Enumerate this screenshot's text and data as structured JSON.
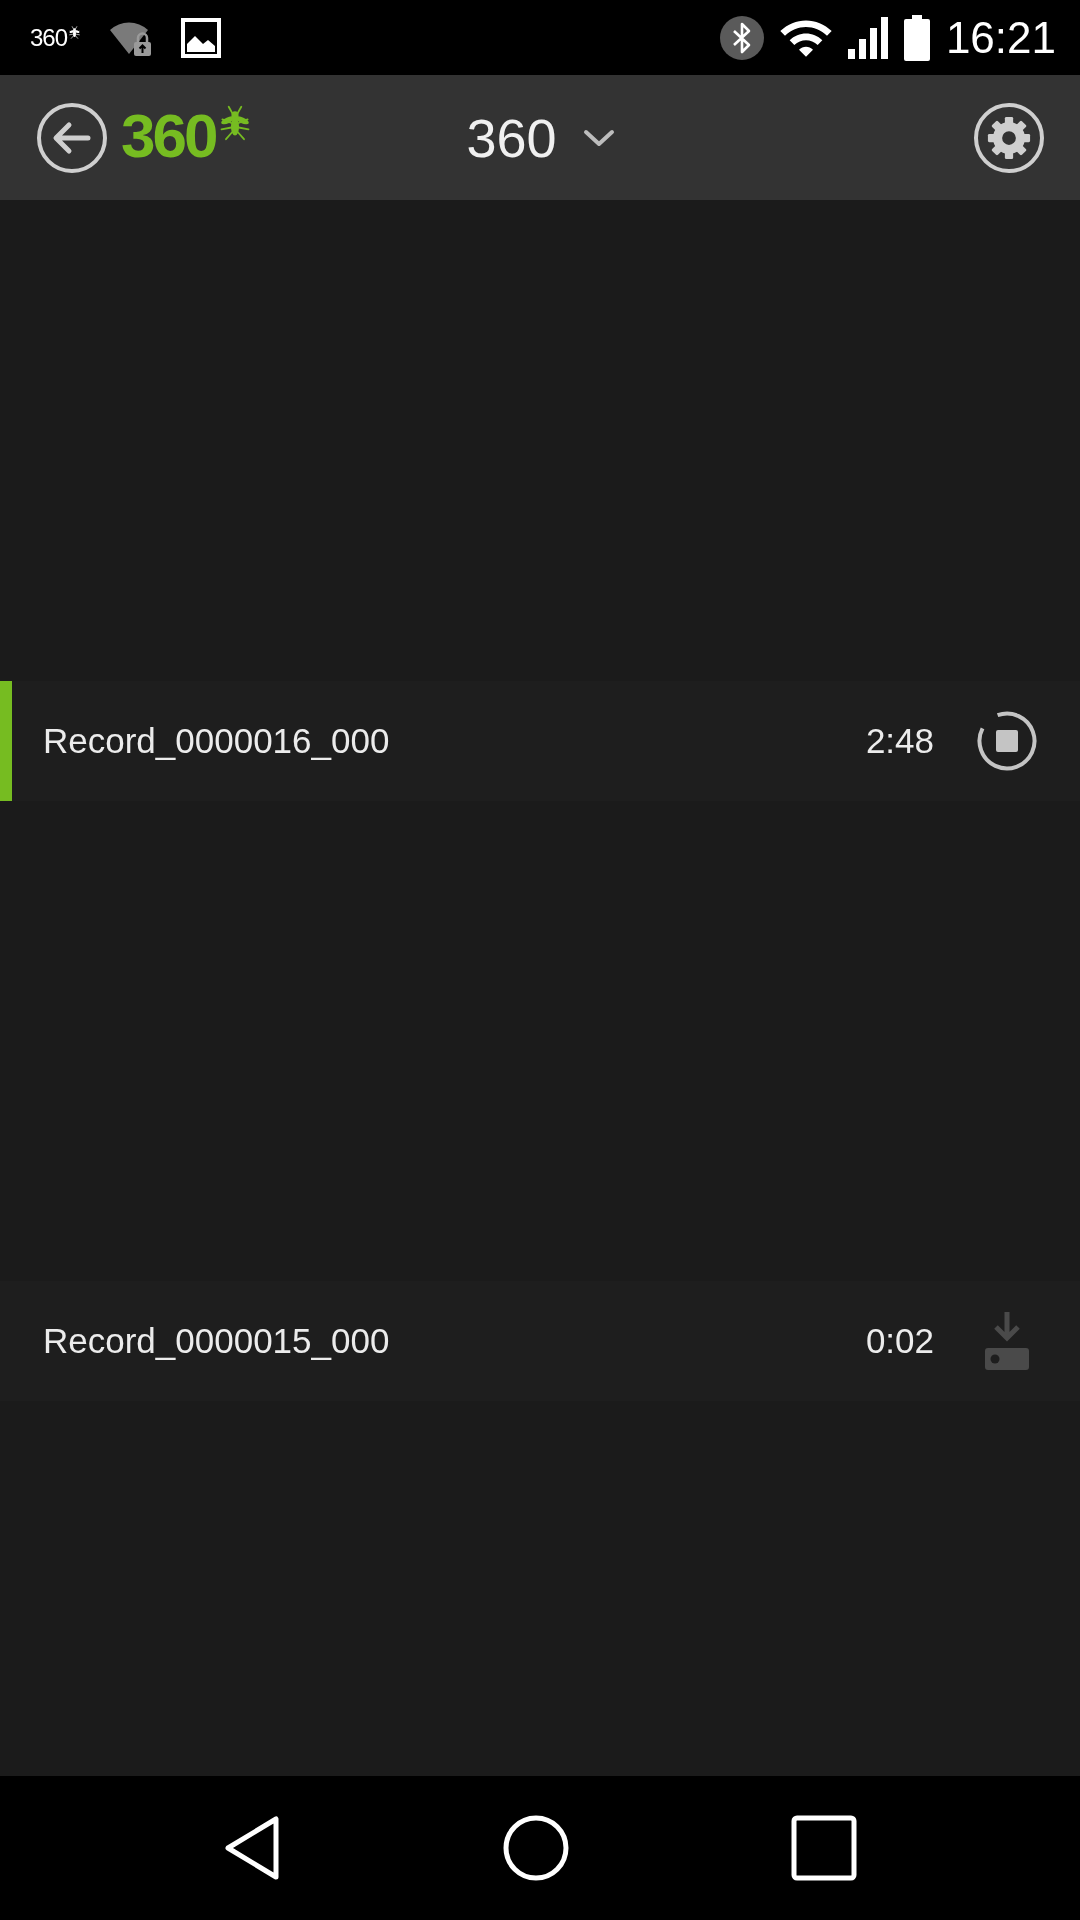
{
  "status_bar": {
    "app_logo_text": "360",
    "time": "16:21"
  },
  "header": {
    "logo_text": "360",
    "title": "360"
  },
  "records": [
    {
      "name": "Record_0000016_000",
      "duration": "2:48",
      "selected": true,
      "kind": "recording"
    },
    {
      "name": "Record_0000015_000",
      "duration": "0:02",
      "selected": false,
      "kind": "download"
    }
  ]
}
